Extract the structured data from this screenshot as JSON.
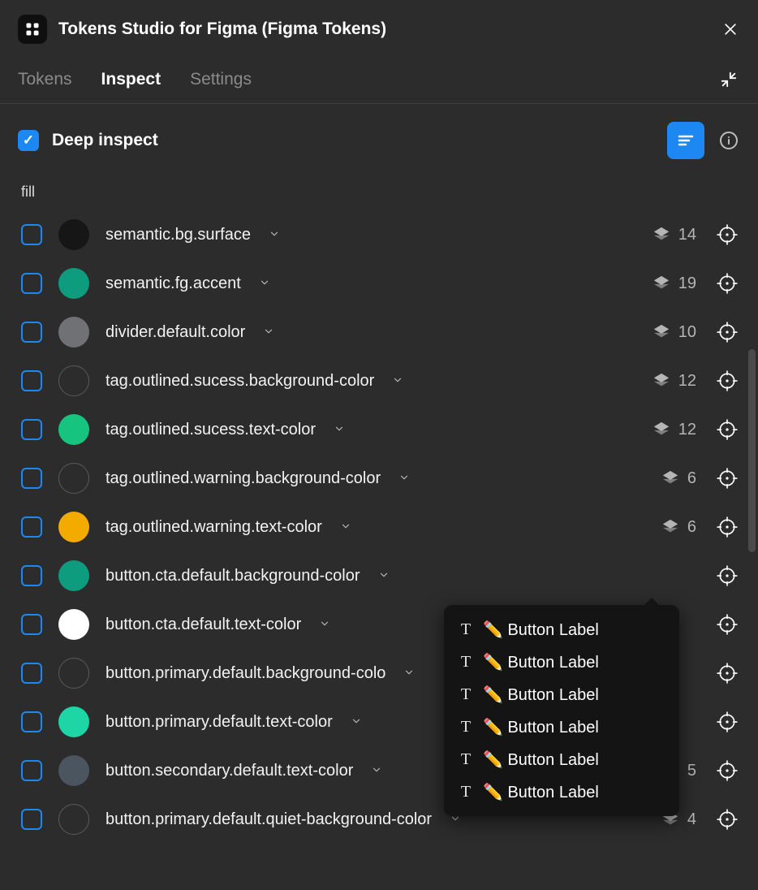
{
  "header": {
    "title": "Tokens Studio for Figma (Figma Tokens)"
  },
  "tabs": {
    "tokens": "Tokens",
    "inspect": "Inspect",
    "settings": "Settings"
  },
  "inspect_bar": {
    "deep_label": "Deep inspect"
  },
  "section": {
    "label": "fill"
  },
  "tokens_list": [
    {
      "swatch": "#161616",
      "outlined": false,
      "name": "semantic.bg.surface",
      "count": "14",
      "hideCount": false
    },
    {
      "swatch": "#0e9c7e",
      "outlined": false,
      "name": "semantic.fg.accent",
      "count": "19",
      "hideCount": false
    },
    {
      "swatch": "#6f7175",
      "outlined": false,
      "name": "divider.default.color",
      "count": "10",
      "hideCount": false
    },
    {
      "swatch": "",
      "outlined": true,
      "name": "tag.outlined.sucess.background-color",
      "count": "12",
      "hideCount": false
    },
    {
      "swatch": "#16c47f",
      "outlined": false,
      "name": "tag.outlined.sucess.text-color",
      "count": "12",
      "hideCount": false
    },
    {
      "swatch": "",
      "outlined": true,
      "name": "tag.outlined.warning.background-color",
      "count": "6",
      "hideCount": false
    },
    {
      "swatch": "#f3ab00",
      "outlined": false,
      "name": "tag.outlined.warning.text-color",
      "count": "6",
      "hideCount": false
    },
    {
      "swatch": "#0e9c7e",
      "outlined": false,
      "name": "button.cta.default.background-color",
      "count": "",
      "hideCount": true
    },
    {
      "swatch": "#ffffff",
      "outlined": false,
      "name": "button.cta.default.text-color",
      "count": "",
      "hideCount": true
    },
    {
      "swatch": "",
      "outlined": true,
      "name": "button.primary.default.background-colo",
      "count": "",
      "hideCount": true
    },
    {
      "swatch": "#1ed6a5",
      "outlined": false,
      "name": "button.primary.default.text-color",
      "count": "",
      "hideCount": true
    },
    {
      "swatch": "#4b5560",
      "outlined": false,
      "name": "button.secondary.default.text-color",
      "count": "5",
      "hideCount": false
    },
    {
      "swatch": "",
      "outlined": true,
      "name": "button.primary.default.quiet-background-color",
      "count": "4",
      "hideCount": false
    }
  ],
  "popover": {
    "items": [
      "✏️ Button Label",
      "✏️ Button Label",
      "✏️ Button Label",
      "✏️ Button Label",
      "✏️ Button Label",
      "✏️ Button Label"
    ]
  }
}
